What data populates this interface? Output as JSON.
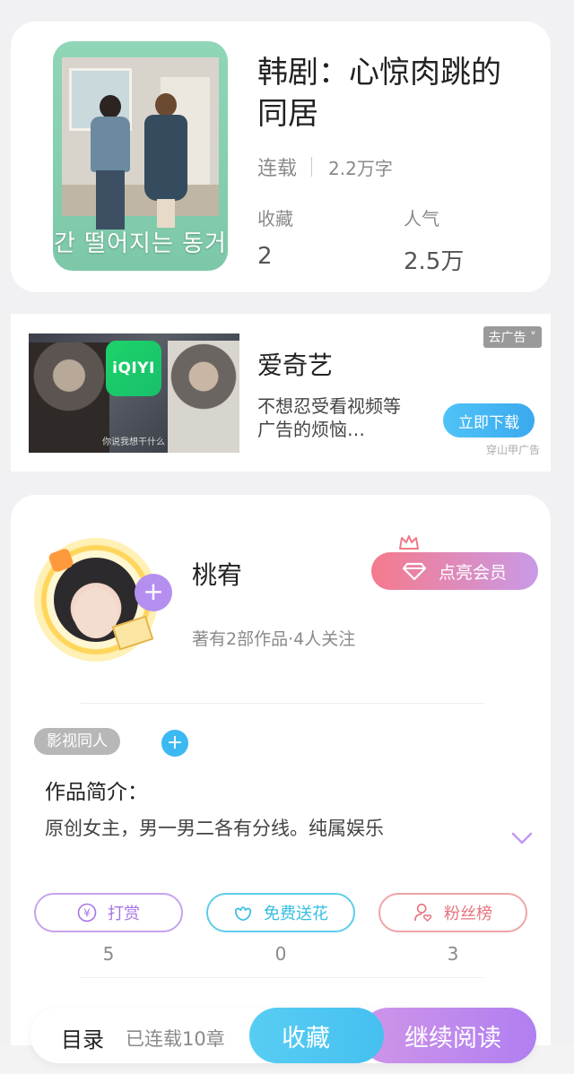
{
  "book": {
    "cover_title": "간 떨어지는 동거",
    "title": "韩剧：心惊肉跳的同居",
    "status": "连载",
    "word_count": "2.2万字",
    "favorites_label": "收藏",
    "favorites_value": "2",
    "popularity_label": "人气",
    "popularity_value": "2.5万"
  },
  "ad": {
    "logo_text": "iQIYI",
    "image_caption": "你说我想干什么",
    "name": "爱奇艺",
    "description": "不想忍受看视频等广告的烦恼…",
    "close_label": "去广告",
    "download_label": "立即下载",
    "source": "穿山甲广告"
  },
  "author": {
    "name": "桃宥",
    "vip_label": "点亮会员",
    "stats": "著有2部作品·4人关注",
    "tag": "影视同人",
    "intro_title": "作品简介：",
    "intro_text": "原创女主，男一男二各有分线。纯属娱乐",
    "actions": [
      {
        "label": "打赏",
        "count": "5",
        "icon": "yen-coin-icon"
      },
      {
        "label": "免费送花",
        "count": "0",
        "icon": "flower-icon"
      },
      {
        "label": "粉丝榜",
        "count": "3",
        "icon": "fan-heart-icon"
      }
    ]
  },
  "bottom": {
    "toc_label": "目录",
    "chapter_count": "已连载10章",
    "favorite_label": "收藏",
    "read_label": "继续阅读"
  },
  "colors": {
    "accent_blue": "#45c0f0",
    "accent_purple": "#b07ff1",
    "vip_pink": "#f57a8c"
  }
}
